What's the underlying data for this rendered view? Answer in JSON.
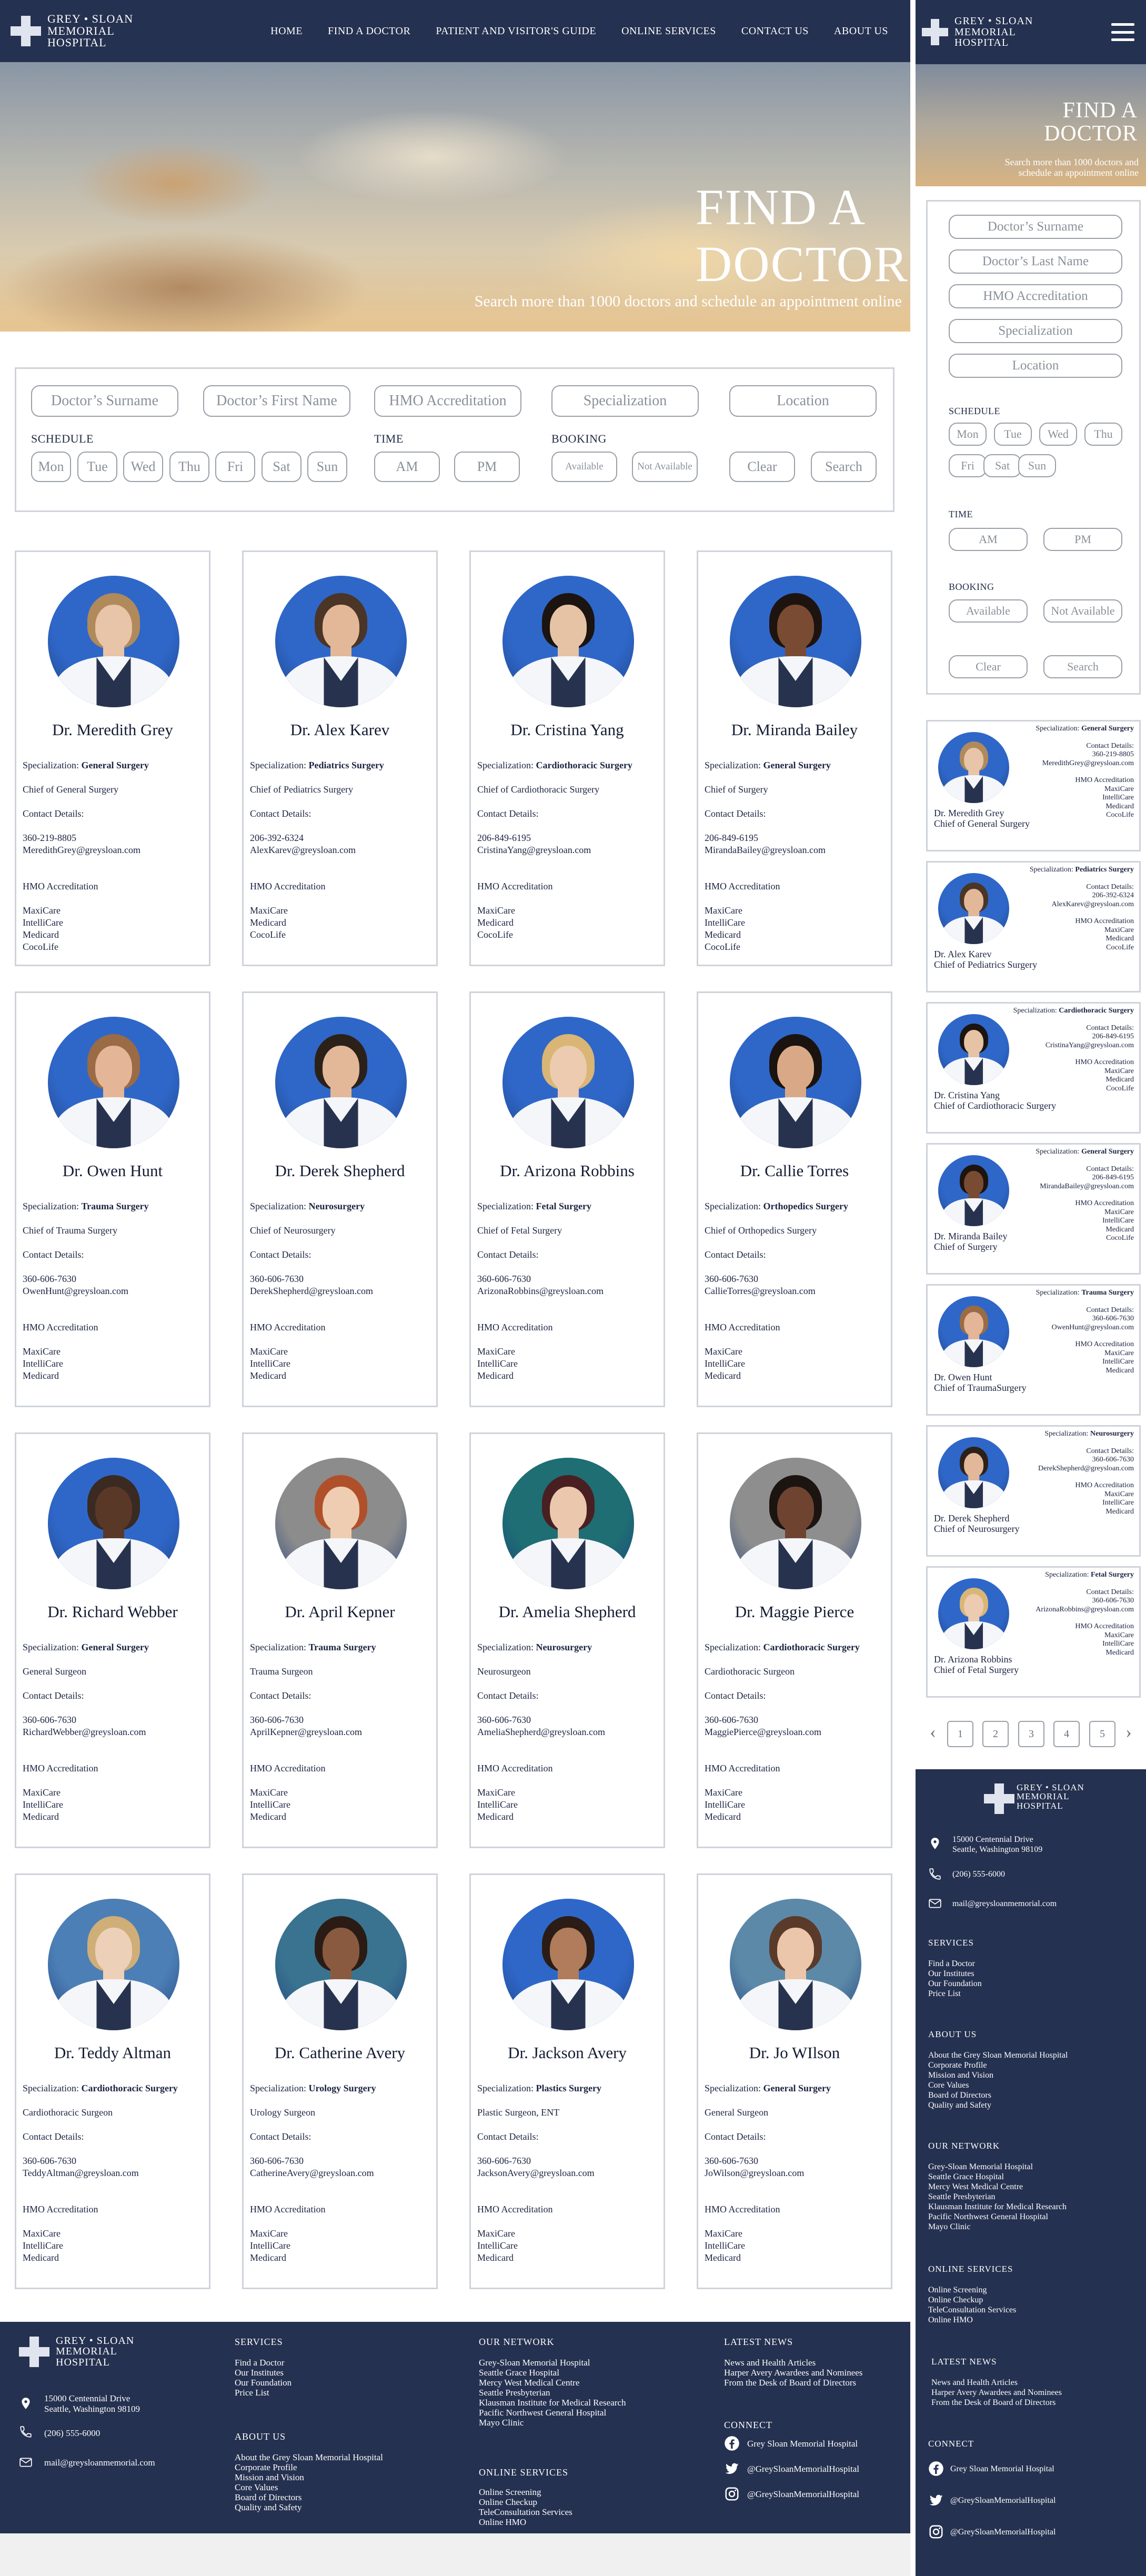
{
  "brand": {
    "line1": "GREY • SLOAN",
    "line2": "MEMORIAL",
    "line3": "HOSPITAL"
  },
  "nav": [
    "HOME",
    "FIND A DOCTOR",
    "PATIENT AND VISITOR'S GUIDE",
    "ONLINE SERVICES",
    "CONTACT US",
    "ABOUT US"
  ],
  "hero": {
    "title_line1": "FIND A",
    "title_line2": "DOCTOR",
    "subtitle": "Search more than 1000 doctors and schedule an appointment online"
  },
  "filters": {
    "surname_placeholder": "Doctor’s Surname",
    "first_name_placeholder": "Doctor’s First Name",
    "last_name_placeholder": "Doctor’s Last Name",
    "hmo_placeholder": "HMO Accreditation",
    "specialization_placeholder": "Specialization",
    "location_placeholder": "Location",
    "schedule_label": "SCHEDULE",
    "days": [
      "Mon",
      "Tue",
      "Wed",
      "Thu",
      "Fri",
      "Sat",
      "Sun"
    ],
    "time_label": "TIME",
    "times": [
      "AM",
      "PM"
    ],
    "booking_label": "BOOKING",
    "booking": [
      "Available",
      "Not Available"
    ],
    "clear": "Clear",
    "search": "Search"
  },
  "labels": {
    "specialization": "Specialization: ",
    "contact": "Contact Details:",
    "hmo": "HMO Accreditation"
  },
  "doctors": [
    {
      "name": "Dr. Meredith Grey",
      "spec": "General Surgery",
      "title": "Chief of General Surgery",
      "phone": "360-219-8805",
      "email": "MeredithGrey@greysloan.com",
      "hmo": [
        "MaxiCare",
        "IntelliCare",
        "Medicard",
        "CocoLife"
      ],
      "skin": "#e8c4a8",
      "hair": "#b08a5a",
      "bg": "#2f67c9"
    },
    {
      "name": "Dr. Alex Karev",
      "spec": "Pediatrics Surgery",
      "title": "Chief of Pediatrics Surgery",
      "phone": "206-392-6324",
      "email": "AlexKarev@greysloan.com",
      "hmo": [
        "MaxiCare",
        "Medicard",
        "CocoLife"
      ],
      "skin": "#e2b898",
      "hair": "#4a3526",
      "bg": "#2f67c9"
    },
    {
      "name": "Dr. Cristina Yang",
      "spec": "Cardiothoracic Surgery",
      "title": "Chief of Cardiothoracic Surgery",
      "phone": "206-849-6195",
      "email": "CristinaYang@greysloan.com",
      "hmo": [
        "MaxiCare",
        "Medicard",
        "CocoLife"
      ],
      "skin": "#e6c3a4",
      "hair": "#1b1410",
      "bg": "#2f67c9"
    },
    {
      "name": "Dr. Miranda Bailey",
      "spec": "General Surgery",
      "title": "Chief of Surgery",
      "phone": "206-849-6195",
      "email": "MirandaBailey@greysloan.com",
      "hmo": [
        "MaxiCare",
        "IntelliCare",
        "Medicard",
        "CocoLife"
      ],
      "skin": "#7a4b33",
      "hair": "#1e140f",
      "bg": "#2f67c9"
    },
    {
      "name": "Dr. Owen Hunt",
      "spec": "Trauma Surgery",
      "title": "Chief of Trauma Surgery",
      "phone": "360-606-7630",
      "email": "OwenHunt@greysloan.com",
      "hmo": [
        "MaxiCare",
        "IntelliCare",
        "Medicard"
      ],
      "skin": "#e4b596",
      "hair": "#9a6b45",
      "bg": "#2f67c9"
    },
    {
      "name": "Dr. Derek Shepherd",
      "spec": "Neurosurgery",
      "title": "Chief of Neurosurgery",
      "phone": "360-606-7630",
      "email": "DerekShepherd@greysloan.com",
      "hmo": [
        "MaxiCare",
        "IntelliCare",
        "Medicard"
      ],
      "skin": "#e2b898",
      "hair": "#2c2119",
      "bg": "#2f67c9"
    },
    {
      "name": "Dr. Arizona Robbins",
      "spec": "Fetal Surgery",
      "title": "Chief of Fetal Surgery",
      "phone": "360-606-7630",
      "email": "ArizonaRobbins@greysloan.com",
      "hmo": [
        "MaxiCare",
        "IntelliCare",
        "Medicard"
      ],
      "skin": "#eccbb0",
      "hair": "#d9b675",
      "bg": "#2f67c9"
    },
    {
      "name": "Dr. Callie Torres",
      "spec": "Orthopedics Surgery",
      "title": "Chief of Orthopedics  Surgery",
      "phone": "360-606-7630",
      "email": "CallieTorres@greysloan.com",
      "hmo": [
        "MaxiCare",
        "IntelliCare",
        "Medicard"
      ],
      "skin": "#d9a987",
      "hair": "#1a1310",
      "bg": "#2f67c9"
    },
    {
      "name": "Dr. Richard Webber",
      "spec": "General Surgery",
      "title": "General Surgeon",
      "phone": "360-606-7630",
      "email": "RichardWebber@greysloan.com",
      "hmo": [
        "MaxiCare",
        "IntelliCare",
        "Medicard"
      ],
      "skin": "#5a3828",
      "hair": "#3a2a22",
      "bg": "#2f67c9"
    },
    {
      "name": "Dr. April Kepner",
      "spec": "Trauma Surgery",
      "title": "Trauma Surgeon",
      "phone": "360-606-7630",
      "email": "AprilKepner@greysloan.com",
      "hmo": [
        "MaxiCare",
        "IntelliCare",
        "Medicard"
      ],
      "skin": "#efcdb3",
      "hair": "#b0502a",
      "bg": "#8c8c8c"
    },
    {
      "name": "Dr. Amelia Shepherd",
      "spec": "Neurosurgery",
      "title": "Neurosurgeon",
      "phone": "360-606-7630",
      "email": "AmeliaShepherd@greysloan.com",
      "hmo": [
        "MaxiCare",
        "IntelliCare",
        "Medicard"
      ],
      "skin": "#ebc8ad",
      "hair": "#4a1f22",
      "bg": "#1e6e74"
    },
    {
      "name": "Dr. Maggie Pierce",
      "spec": "Cardiothoracic Surgery",
      "title": "Cardiothoracic Surgeon",
      "phone": "360-606-7630",
      "email": "MaggiePierce@greysloan.com",
      "hmo": [
        "MaxiCare",
        "IntelliCare",
        "Medicard"
      ],
      "skin": "#6e4431",
      "hair": "#1c1410",
      "bg": "#8e8e8e"
    },
    {
      "name": "Dr. Teddy Altman",
      "spec": "Cardiothoracic Surgery",
      "title": "Cardiothoracic Surgeon",
      "phone": "360-606-7630",
      "email": "TeddyAltman@greysloan.com",
      "hmo": [
        "MaxiCare",
        "IntelliCare",
        "Medicard"
      ],
      "skin": "#edd0b8",
      "hair": "#cfae78",
      "bg": "#4c7fb5"
    },
    {
      "name": "Dr. Catherine Avery",
      "spec": "Urology Surgery",
      "title": "Urology Surgeon",
      "phone": "360-606-7630",
      "email": "CatherineAvery@greysloan.com",
      "hmo": [
        "MaxiCare",
        "IntelliCare",
        "Medicard"
      ],
      "skin": "#8a5a40",
      "hair": "#2a1c15",
      "bg": "#3a7390"
    },
    {
      "name": "Dr. Jackson Avery",
      "spec": "Plastics Surgery",
      "title": "Plastic Surgeon, ENT",
      "phone": "360-606-7630",
      "email": "JacksonAvery@greysloan.com",
      "hmo": [
        "MaxiCare",
        "IntelliCare",
        "Medicard"
      ],
      "skin": "#b07c5c",
      "hair": "#2b1d15",
      "bg": "#2f67c9"
    },
    {
      "name": "Dr. Jo WIlson",
      "spec": "General Surgery",
      "title": "General Surgeon",
      "phone": "360-606-7630",
      "email": "JoWilson@greysloan.com",
      "hmo": [
        "MaxiCare",
        "IntelliCare",
        "Medicard"
      ],
      "skin": "#ebc6aa",
      "hair": "#5a3a2a",
      "bg": "#5c89a8"
    }
  ],
  "mobile_doctors": [
    {
      "name": "Dr. Meredith Grey",
      "title": "Chief of General Surgery",
      "spec": "General Surgery",
      "phone": "360-219-8805",
      "email": "MeredithGrey@greysloan.com",
      "hmo": [
        "MaxiCare",
        "IntelliCare",
        "Medicard",
        "CocoLife"
      ],
      "skin": "#e8c4a8",
      "hair": "#b08a5a",
      "bg": "#2f67c9"
    },
    {
      "name": "Dr. Alex Karev",
      "title": "Chief of Pediatrics Surgery",
      "spec": "Pediatrics Surgery",
      "phone": "206-392-6324",
      "email": "AlexKarev@greysloan.com",
      "hmo": [
        "MaxiCare",
        "Medicard",
        "CocoLife"
      ],
      "skin": "#e2b898",
      "hair": "#4a3526",
      "bg": "#2f67c9"
    },
    {
      "name": "Dr. Cristina Yang",
      "title": "Chief of Cardiothoracic Surgery",
      "spec": "Cardiothoracic Surgery",
      "phone": "206-849-6195",
      "email": "CristinaYang@greysloan.com",
      "hmo": [
        "MaxiCare",
        "Medicard",
        "CocoLife"
      ],
      "skin": "#e6c3a4",
      "hair": "#1b1410",
      "bg": "#2f67c9"
    },
    {
      "name": "Dr. Miranda Bailey",
      "title": "Chief of Surgery",
      "spec": "General Surgery",
      "phone": "206-849-6195",
      "email": "MirandaBailey@greysloan.com",
      "hmo": [
        "MaxiCare",
        "IntelliCare",
        "Medicard",
        "CocoLife"
      ],
      "skin": "#7a4b33",
      "hair": "#1e140f",
      "bg": "#2f67c9"
    },
    {
      "name": "Dr. Owen Hunt",
      "title": "Chief of TraumaSurgery",
      "spec": "Trauma Surgery",
      "phone": "360-606-7630",
      "email": "OwenHunt@greysloan.com",
      "hmo": [
        "MaxiCare",
        "IntelliCare",
        "Medicard"
      ],
      "skin": "#e4b596",
      "hair": "#9a6b45",
      "bg": "#2f67c9"
    },
    {
      "name": "Dr. Derek Shepherd",
      "title": "Chief of Neurosurgery",
      "spec": "Neurosurgery",
      "phone": "360-606-7630",
      "email": "DerekShepherd@greysloan.com",
      "hmo": [
        "MaxiCare",
        "IntelliCare",
        "Medicard"
      ],
      "skin": "#e2b898",
      "hair": "#2c2119",
      "bg": "#2f67c9"
    },
    {
      "name": "Dr. Arizona Robbins",
      "title": "Chief of Fetal Surgery",
      "spec": "Fetal Surgery",
      "phone": "360-606-7630",
      "email": "ArizonaRobbins@greysloan.com",
      "hmo": [
        "MaxiCare",
        "IntelliCare",
        "Medicard"
      ],
      "skin": "#eccbb0",
      "hair": "#d9b675",
      "bg": "#2f67c9"
    }
  ],
  "pagination": {
    "prev": "‹",
    "pages": [
      "1",
      "2",
      "3",
      "4",
      "5"
    ],
    "next": "›"
  },
  "footer": {
    "address1": "15000 Centennial Drive",
    "address2": "Seattle, Washington 98109",
    "phone": "(206) 555-6000",
    "email": "mail@greysloanmemorial.com",
    "services_title": "SERVICES",
    "services": [
      "Find a Doctor",
      "Our Institutes",
      "Our Foundation",
      "Price List"
    ],
    "about_title": "ABOUT US",
    "about": [
      "About the Grey Sloan Memorial Hospital",
      "Corporate Profile",
      "Mission and Vision",
      "Core Values",
      "Board of Directors",
      "Quality and Safety"
    ],
    "network_title": "OUR NETWORK",
    "network": [
      "Grey-Sloan Memorial Hospital",
      "Seattle Grace Hospital",
      "Mercy West Medical Centre",
      "Seattle Presbyterian",
      "Klausman Institute for Medical Research",
      "Pacific Northwest General Hospital",
      "Mayo Clinic"
    ],
    "online_title": "ONLINE SERVICES",
    "online": [
      "Online Screening",
      "Online Checkup",
      "TeleConsultation Services",
      "Online HMO"
    ],
    "news_title": "LATEST NEWS",
    "news": [
      "News and Health Articles",
      "Harper Avery Awardees and Nominees",
      "From the Desk of Board of Directors"
    ],
    "connect_title": "CONNECT",
    "facebook": "Grey Sloan Memorial Hospital",
    "twitter": "@GreySloanMemorialHospital",
    "instagram": "@GreySloanMemorialHospital"
  },
  "colors": {
    "navy": "#253150",
    "border": "#cfd3da",
    "pill_border": "#9aa0a8"
  }
}
